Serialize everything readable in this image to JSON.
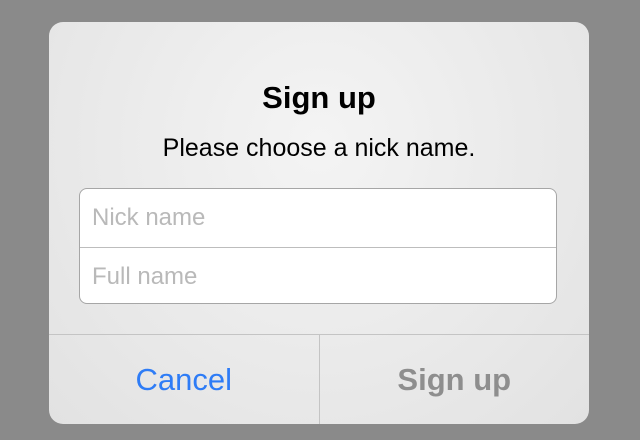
{
  "dialog": {
    "title": "Sign up",
    "message": "Please choose a nick name.",
    "fields": {
      "nick_name": {
        "value": "",
        "placeholder": "Nick name"
      },
      "full_name": {
        "value": "",
        "placeholder": "Full name"
      }
    },
    "buttons": {
      "cancel_label": "Cancel",
      "confirm_label": "Sign up",
      "confirm_enabled": false
    }
  },
  "colors": {
    "backdrop": "#8a8a8a",
    "accent": "#2e7cf6",
    "disabled_text": "#8e8e8e",
    "placeholder": "#b9b9b9"
  }
}
